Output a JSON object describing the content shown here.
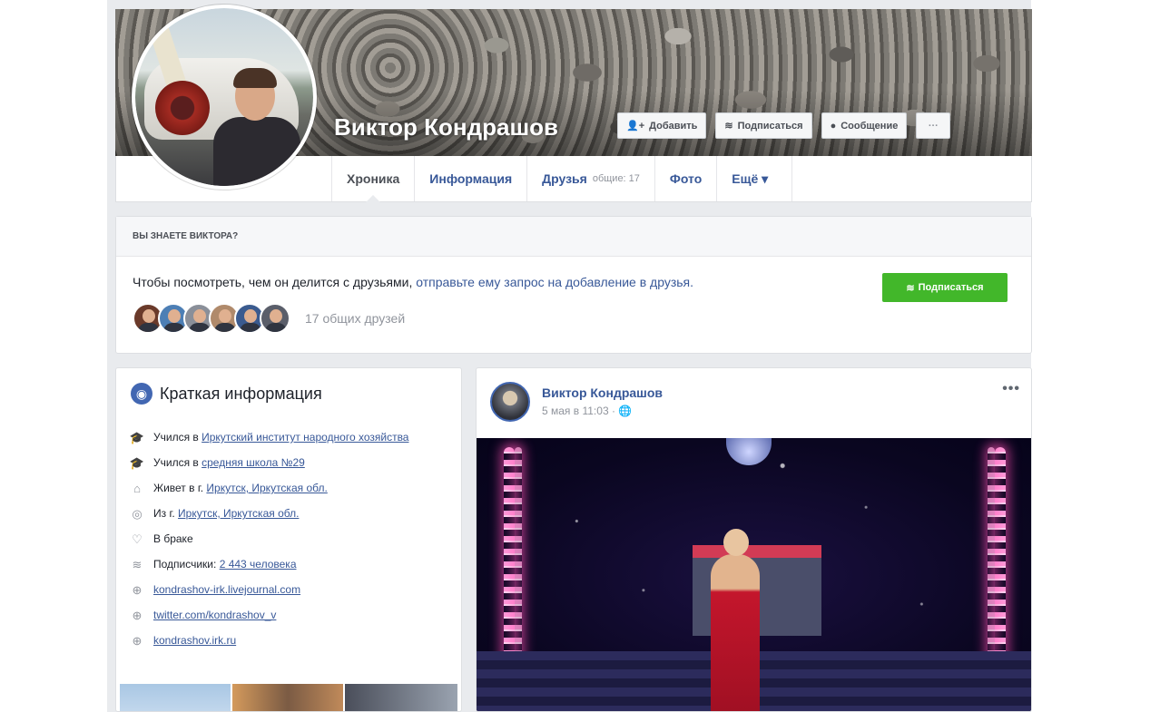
{
  "profile": {
    "name": "Виктор Кондрашов",
    "actions": {
      "add": "Добавить",
      "subscribe": "Подписаться",
      "message": "Сообщение",
      "more": "···"
    }
  },
  "nav": {
    "tabs": [
      {
        "label": "Хроника"
      },
      {
        "label": "Информация"
      },
      {
        "label": "Друзья",
        "sub": "общие: 17"
      },
      {
        "label": "Фото"
      },
      {
        "label": "Ещё ▾"
      }
    ]
  },
  "know": {
    "heading": "ВЫ ЗНАЕТЕ ВИКТОРА?",
    "text_plain": "Чтобы посмотреть, чем он делится с друзьями, ",
    "text_link": "отправьте ему запрос на добавление в друзья.",
    "subscribe": "Подписаться",
    "mutual": "17 общих друзей",
    "avatar_colors": [
      "#6a3a2a",
      "#4d7fb5",
      "#8a8f99",
      "#b08a6b",
      "#3b5b8f",
      "#5a5e6a"
    ]
  },
  "intro": {
    "title": "Краткая информация",
    "items": [
      {
        "icon": "graduation-icon",
        "glyph": "🎓",
        "prefix": "Учился в ",
        "link": "Иркутский институт народного хозяйства"
      },
      {
        "icon": "graduation-icon",
        "glyph": "🎓",
        "prefix": "Учился в ",
        "link": "средняя школа №29"
      },
      {
        "icon": "home-icon",
        "glyph": "⌂",
        "prefix": "Живет в г. ",
        "link": "Иркутск, Иркутская обл."
      },
      {
        "icon": "location-icon",
        "glyph": "◎",
        "prefix": "Из г. ",
        "link": "Иркутск, Иркутская обл."
      },
      {
        "icon": "heart-icon",
        "glyph": "♡",
        "prefix": "В браке",
        "link": ""
      },
      {
        "icon": "rss-icon",
        "glyph": "≋",
        "prefix": "Подписчики: ",
        "link": "2 443 человека"
      },
      {
        "icon": "globe-icon",
        "glyph": "⊕",
        "prefix": "",
        "link": "kondrashov-irk.livejournal.com"
      },
      {
        "icon": "globe-icon",
        "glyph": "⊕",
        "prefix": "",
        "link": "twitter.com/kondrashov_v"
      },
      {
        "icon": "globe-icon",
        "glyph": "⊕",
        "prefix": "",
        "link": "kondrashov.irk.ru"
      }
    ]
  },
  "post": {
    "author": "Виктор Кондрашов",
    "meta": "5 мая в 11:03 · ",
    "privacy_glyph": "🌐",
    "more": "•••"
  }
}
